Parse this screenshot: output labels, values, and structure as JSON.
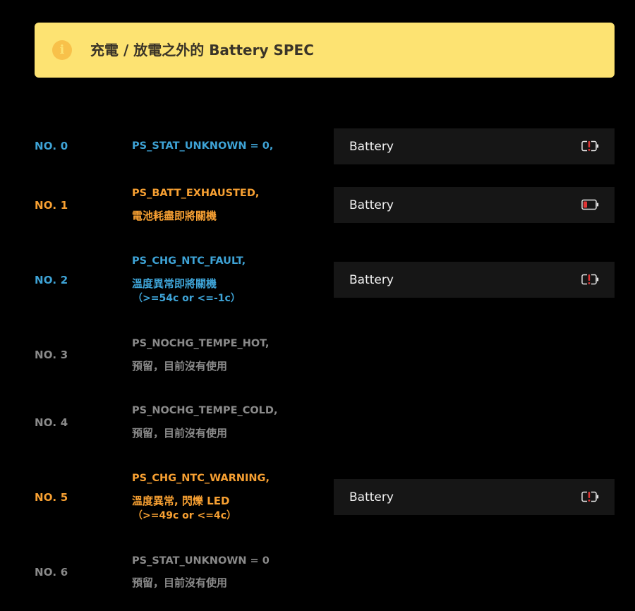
{
  "banner": {
    "title": "充電 / 放電之外的 Battery SPEC",
    "icon": "info-icon",
    "color": "#fde372"
  },
  "colors": {
    "blue": "#3ea3d6",
    "orange": "#f7a032",
    "gray": "#8a8a8a",
    "warning_red": "#e03535"
  },
  "rows": [
    {
      "no": "NO. 0",
      "code": "PS_STAT_UNKNOWN = 0,",
      "desc": "",
      "sub": "",
      "card": {
        "label": "Battery",
        "icon": "battery-alert-icon"
      }
    },
    {
      "no": "NO. 1",
      "code": "PS_BATT_EXHAUSTED,",
      "desc": "電池耗盡即將關機",
      "sub": "",
      "card": {
        "label": "Battery",
        "icon": "battery-low-icon"
      }
    },
    {
      "no": "NO. 2",
      "code": "PS_CHG_NTC_FAULT,",
      "desc": "溫度異常即將關機",
      "sub": "（>=54c or <=-1c）",
      "card": {
        "label": "Battery",
        "icon": "battery-alert-icon"
      }
    },
    {
      "no": "NO. 3",
      "code": "PS_NOCHG_TEMPE_HOT,",
      "desc": "預留，目前沒有使用",
      "sub": ""
    },
    {
      "no": "NO. 4",
      "code": "PS_NOCHG_TEMPE_COLD,",
      "desc": "預留，目前沒有使用",
      "sub": ""
    },
    {
      "no": "NO. 5",
      "code": "PS_CHG_NTC_WARNING,",
      "desc": "溫度異常, 閃爍 LED",
      "sub": "（>=49c or <=4c）",
      "card": {
        "label": "Battery",
        "icon": "battery-alert-icon"
      }
    },
    {
      "no": "NO. 6",
      "code": "PS_STAT_UNKNOWN = 0",
      "desc": "預留，目前沒有使用",
      "sub": ""
    }
  ]
}
